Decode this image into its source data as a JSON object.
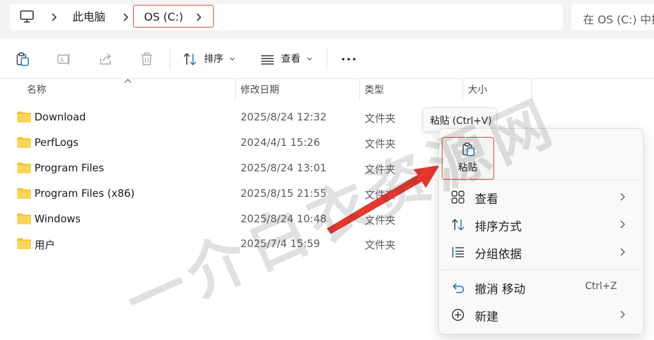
{
  "address_bar": {
    "crumbs": [
      "此电脑",
      "OS (C:)"
    ],
    "search_placeholder": "在 OS (C:) 中搜"
  },
  "toolbar": {
    "sort_label": "排序",
    "view_label": "查看"
  },
  "columns": {
    "name": "名称",
    "date": "修改日期",
    "type": "类型",
    "size": "大小"
  },
  "files": [
    {
      "name": "Download",
      "date": "2025/8/24 12:32",
      "type": "文件夹"
    },
    {
      "name": "PerfLogs",
      "date": "2024/4/1 15:26",
      "type": "文件夹"
    },
    {
      "name": "Program Files",
      "date": "2025/8/24 13:01",
      "type": "文件夹"
    },
    {
      "name": "Program Files (x86)",
      "date": "2025/8/15 21:55",
      "type": "文件夹"
    },
    {
      "name": "Windows",
      "date": "2025/8/24 10:48",
      "type": "文件夹"
    },
    {
      "name": "用户",
      "date": "2025/7/4 15:59",
      "type": "文件夹"
    }
  ],
  "tooltip": "粘贴 (Ctrl+V)",
  "context_menu": {
    "paste_label": "粘贴",
    "items": [
      {
        "label": "查看",
        "icon": "view-grid-icon"
      },
      {
        "label": "排序方式",
        "icon": "sort-icon"
      },
      {
        "label": "分组依据",
        "icon": "group-list-icon"
      },
      {
        "label": "撤消 移动",
        "icon": "undo-icon",
        "shortcut": "Ctrl+Z"
      },
      {
        "label": "新建",
        "icon": "new-plus-icon"
      }
    ]
  },
  "watermark": "一介白衣资源网",
  "colors": {
    "highlight": "#e0473f",
    "arrow": "#e5362f",
    "folder": "#f8c434",
    "accent_icon": "#1a73c7"
  }
}
